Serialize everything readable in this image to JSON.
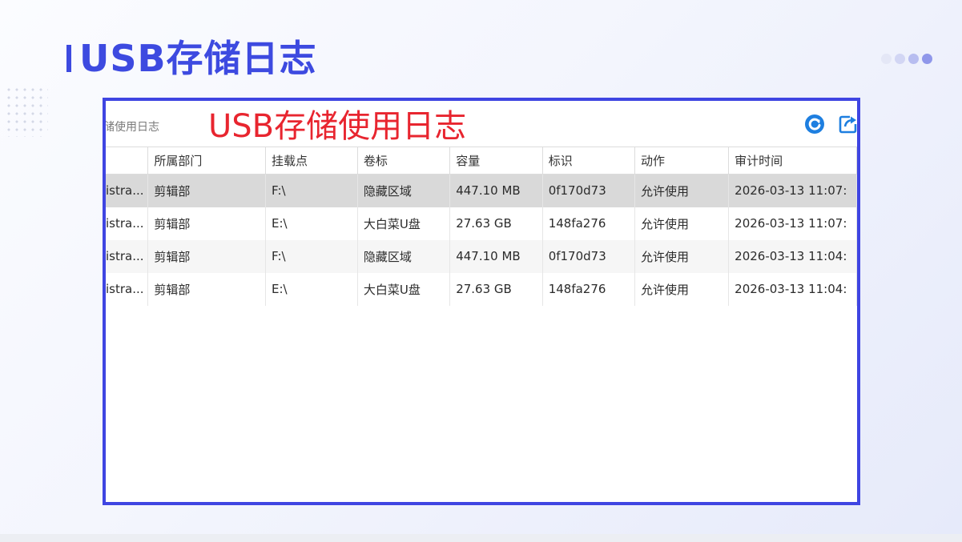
{
  "slide": {
    "title": "USB存储日志",
    "accent_color": "#3d4ae0",
    "decor_dots": [
      "#e4e7f6",
      "#d2d6f4",
      "#b7bdf0",
      "#8f97ea"
    ]
  },
  "window": {
    "title_fragment": "储使用日志",
    "annotation": "USB存储使用日志",
    "annotation_color": "#e8252f",
    "frame_color": "#3f45e2",
    "toolbar": {
      "refresh_icon": "refresh-icon",
      "export_icon": "export-icon"
    }
  },
  "table": {
    "columns": [
      "",
      "所属部门",
      "挂载点",
      "卷标",
      "容量",
      "标识",
      "动作",
      "审计时间"
    ],
    "rows": [
      [
        "istra...",
        "剪辑部",
        "F:\\",
        "隐藏区域",
        "447.10 MB",
        "0f170d73",
        "允许使用",
        "2026-03-13 11:07:"
      ],
      [
        "istra...",
        "剪辑部",
        "E:\\",
        "大白菜U盘",
        "27.63 GB",
        "148fa276",
        "允许使用",
        "2026-03-13 11:07:"
      ],
      [
        "istra...",
        "剪辑部",
        "F:\\",
        "隐藏区域",
        "447.10 MB",
        "0f170d73",
        "允许使用",
        "2026-03-13 11:04:"
      ],
      [
        "istra...",
        "剪辑部",
        "E:\\",
        "大白菜U盘",
        "27.63 GB",
        "148fa276",
        "允许使用",
        "2026-03-13 11:04:"
      ]
    ]
  }
}
